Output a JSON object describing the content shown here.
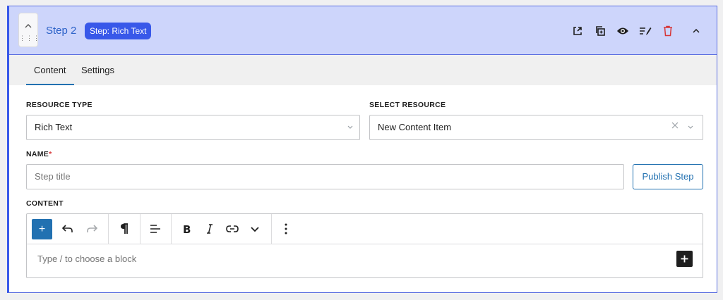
{
  "header": {
    "step_title": "Step 2",
    "badge": "Step: Rich Text",
    "actions": [
      "external-link-icon",
      "duplicate-icon",
      "eye-icon",
      "edit-list-icon",
      "trash-icon",
      "chevron-up-icon"
    ],
    "colors": {
      "accent": "#3858e9",
      "header_bg": "#cdd5fb",
      "trash": "#d63638"
    }
  },
  "tabs": [
    {
      "label": "Content",
      "active": true
    },
    {
      "label": "Settings",
      "active": false
    }
  ],
  "form": {
    "resource_type": {
      "label": "RESOURCE TYPE",
      "value": "Rich Text"
    },
    "select_resource": {
      "label": "SELECT RESOURCE",
      "value": "New Content Item"
    },
    "name": {
      "label": "NAME",
      "required_mark": "*",
      "placeholder": "Step title"
    },
    "publish_label": "Publish Step",
    "content_label": "CONTENT"
  },
  "editor": {
    "placeholder": "Type / to choose a block",
    "toolbar_add": "+"
  }
}
